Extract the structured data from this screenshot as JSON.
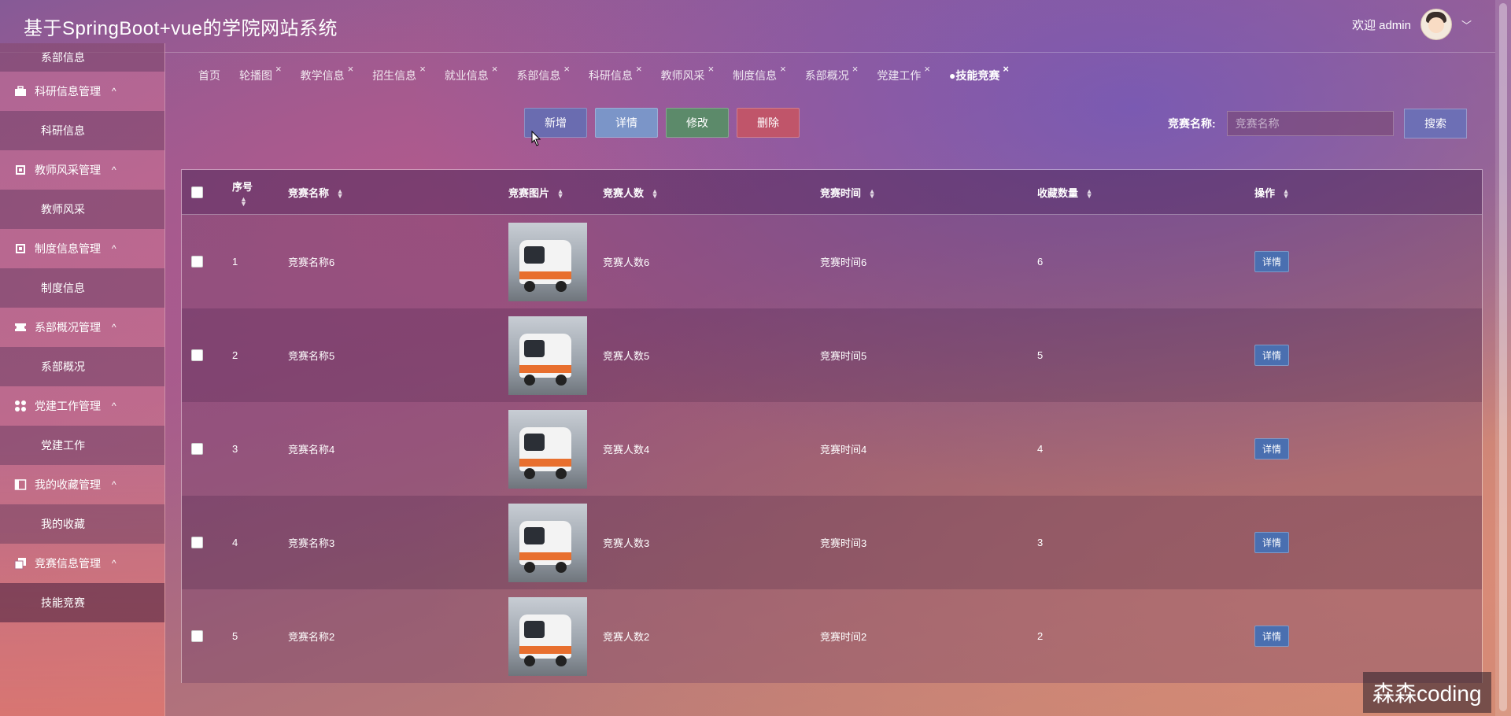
{
  "header": {
    "app_title": "基于SpringBoot+vue的学院网站系统",
    "welcome": "欢迎 admin"
  },
  "sidebar": {
    "top_sub": "系部信息",
    "groups": [
      {
        "title": "科研信息管理",
        "sub": "科研信息",
        "icon": "briefcase-icon"
      },
      {
        "title": "教师风采管理",
        "sub": "教师风采",
        "icon": "chip-icon"
      },
      {
        "title": "制度信息管理",
        "sub": "制度信息",
        "icon": "chip-icon"
      },
      {
        "title": "系部概况管理",
        "sub": "系部概况",
        "icon": "ticket-icon"
      },
      {
        "title": "党建工作管理",
        "sub": "党建工作",
        "icon": "grid-dots-icon"
      },
      {
        "title": "我的收藏管理",
        "sub": "我的收藏",
        "icon": "panel-icon"
      },
      {
        "title": "竞赛信息管理",
        "sub": "技能竞赛",
        "icon": "copy-icon"
      }
    ],
    "caret": "^"
  },
  "tabs": [
    {
      "label": "首页",
      "closable": false
    },
    {
      "label": "轮播图",
      "closable": true
    },
    {
      "label": "教学信息",
      "closable": true
    },
    {
      "label": "招生信息",
      "closable": true
    },
    {
      "label": "就业信息",
      "closable": true
    },
    {
      "label": "系部信息",
      "closable": true
    },
    {
      "label": "科研信息",
      "closable": true
    },
    {
      "label": "教师风采",
      "closable": true
    },
    {
      "label": "制度信息",
      "closable": true
    },
    {
      "label": "系部概况",
      "closable": true
    },
    {
      "label": "党建工作",
      "closable": true
    },
    {
      "label": "●技能竞赛",
      "closable": true,
      "active": true
    }
  ],
  "toolbar": {
    "add_label": "新增",
    "detail_label": "详情",
    "edit_label": "修改",
    "delete_label": "删除"
  },
  "search": {
    "label": "竞赛名称:",
    "placeholder": "竞赛名称",
    "button_label": "搜索"
  },
  "table": {
    "columns": [
      "序号",
      "竞赛名称",
      "竞赛图片",
      "竞赛人数",
      "竞赛时间",
      "收藏数量",
      "操作"
    ],
    "rows": [
      {
        "no": "1",
        "name": "竞赛名称6",
        "count": "竞赛人数6",
        "time": "竞赛时间6",
        "fav": "6",
        "op": "详情"
      },
      {
        "no": "2",
        "name": "竞赛名称5",
        "count": "竞赛人数5",
        "time": "竞赛时间5",
        "fav": "5",
        "op": "详情"
      },
      {
        "no": "3",
        "name": "竞赛名称4",
        "count": "竞赛人数4",
        "time": "竞赛时间4",
        "fav": "4",
        "op": "详情"
      },
      {
        "no": "4",
        "name": "竞赛名称3",
        "count": "竞赛人数3",
        "time": "竞赛时间3",
        "fav": "3",
        "op": "详情"
      },
      {
        "no": "5",
        "name": "竞赛名称2",
        "count": "竞赛人数2",
        "time": "竞赛时间2",
        "fav": "2",
        "op": "详情"
      }
    ]
  },
  "watermark": "森森coding"
}
